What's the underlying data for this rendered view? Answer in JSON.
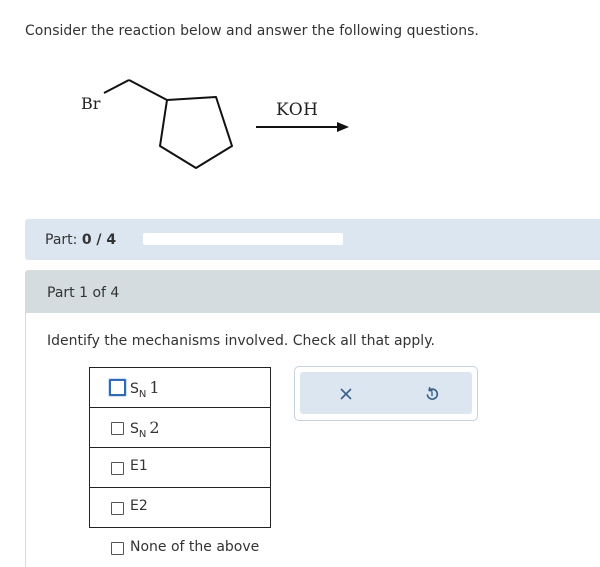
{
  "question": {
    "prompt": "Consider the reaction below and answer the following questions."
  },
  "reaction": {
    "substituent_label": "Br",
    "reagent_label": "KOH",
    "molecule_icon": "bromomethylcyclopentane-structure",
    "arrow_icon": "reaction-arrow-icon"
  },
  "progress": {
    "label_prefix": "Part:",
    "score": "0 / 4",
    "fraction": 0.0
  },
  "part": {
    "header": "Part 1 of 4",
    "instruction": "Identify the mechanisms involved. Check all that apply.",
    "choices": [
      {
        "main": "S",
        "sub": "N",
        "suffix": "1",
        "checked": false,
        "focused": true
      },
      {
        "main": "S",
        "sub": "N",
        "suffix": "2",
        "checked": false,
        "focused": false
      },
      {
        "label": "E1",
        "checked": false
      },
      {
        "label": "E2",
        "checked": false
      }
    ],
    "none_option": "None of the above"
  },
  "actions": {
    "clear_icon": "close-icon",
    "undo_icon": "undo-icon"
  },
  "colors": {
    "progress_bar_bg": "#dce6f1",
    "part_header_bg": "#d5dcdf",
    "focus_outline": "#2f6bb5",
    "action_panel_bg": "#dce6f1"
  }
}
